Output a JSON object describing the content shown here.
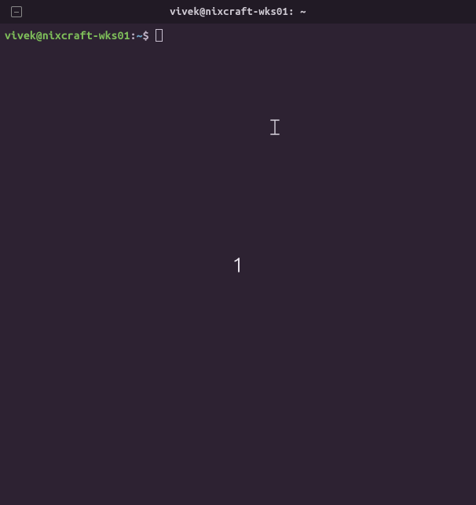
{
  "titlebar": {
    "title": "vivek@nixcraft-wks01: ~"
  },
  "prompt": {
    "user_host": "vivek@nixcraft-wks01",
    "sep1": ":",
    "path": "~",
    "sigil": "$"
  },
  "overlay": {
    "number": "1"
  }
}
